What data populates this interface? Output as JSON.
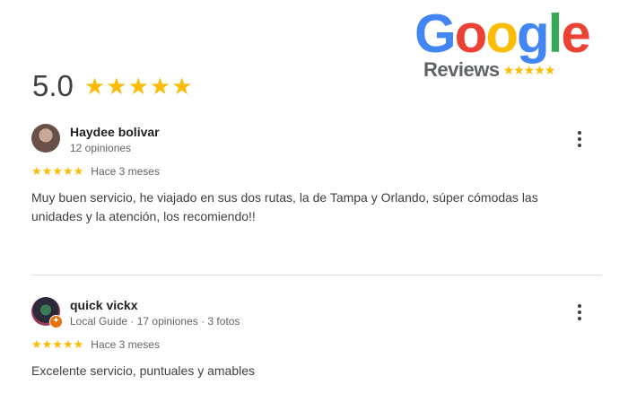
{
  "logo": {
    "letters": [
      {
        "ch": "G",
        "color": "#4285f4"
      },
      {
        "ch": "o",
        "color": "#ea4335"
      },
      {
        "ch": "o",
        "color": "#fbbc05"
      },
      {
        "ch": "g",
        "color": "#4285f4"
      },
      {
        "ch": "l",
        "color": "#34a853"
      },
      {
        "ch": "e",
        "color": "#ea4335"
      }
    ],
    "sub": "Reviews",
    "stars": "★★★★★"
  },
  "summary": {
    "rating": "5.0",
    "stars": "★★★★★"
  },
  "reviews": [
    {
      "name": "Haydee bolivar",
      "meta": "12 opiniones",
      "stars": "★★★★★",
      "when": "Hace 3 meses",
      "text": "Muy buen servicio, he viajado en sus dos rutas, la de Tampa y Orlando, súper cómodas las unidades y la atención, los recomiendo!!"
    },
    {
      "name": "quick vickx",
      "meta": "Local Guide · 17 opiniones · 3 fotos",
      "stars": "★★★★★",
      "when": "Hace 3 meses",
      "text": "Excelente servicio, puntuales y amables"
    }
  ],
  "colors": {
    "star": "#fbbc05",
    "local_guide_badge": "#e8710a"
  }
}
